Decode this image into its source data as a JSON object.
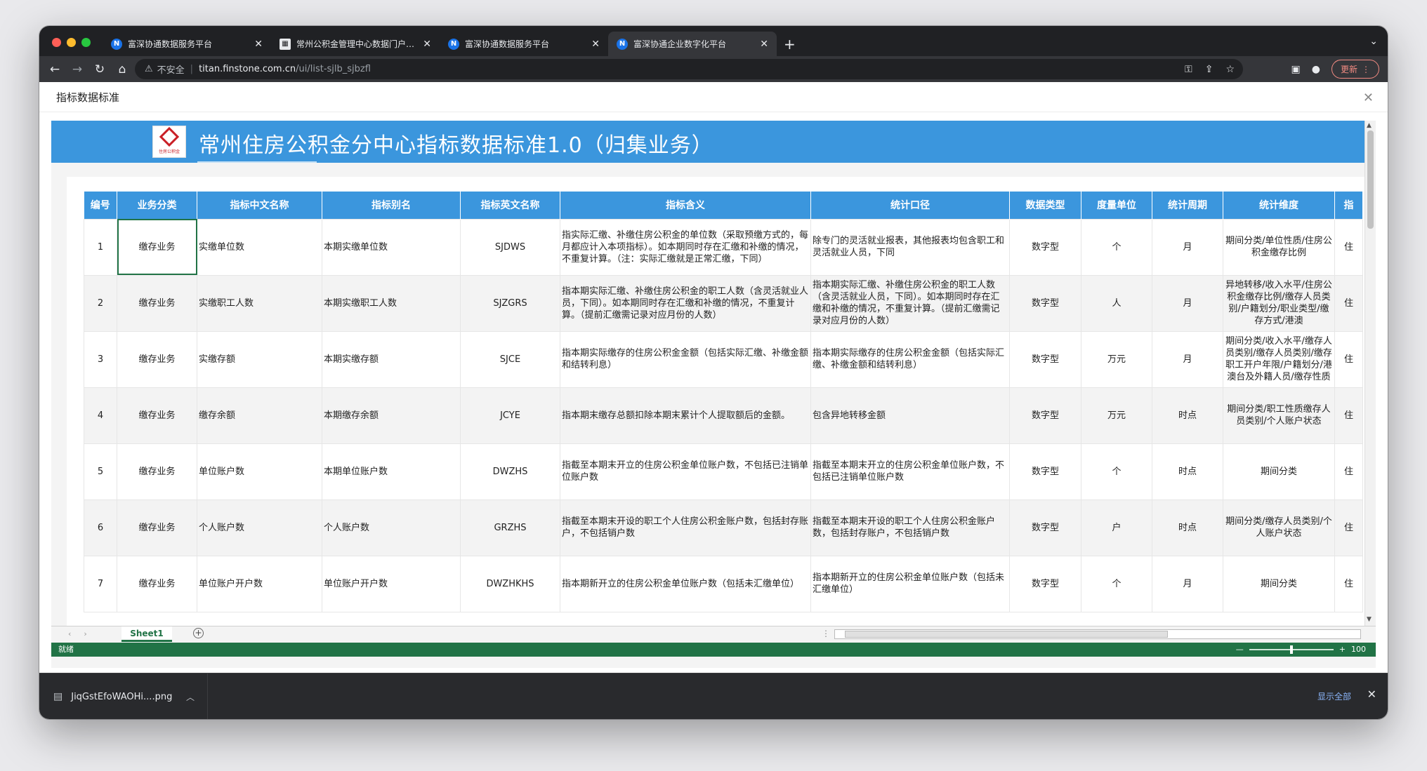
{
  "tabs": [
    {
      "title": "富深协通数据服务平台",
      "icon": "N",
      "active": false
    },
    {
      "title": "常州公积金管理中心数据门户建设",
      "icon": "doc",
      "active": false
    },
    {
      "title": "富深协通数据服务平台",
      "icon": "N",
      "active": false
    },
    {
      "title": "富深协通企业数字化平台",
      "icon": "N",
      "active": true
    }
  ],
  "toolbar": {
    "insecure_label": "不安全",
    "url_host": "titan.finstone.com.cn",
    "url_path": "/ui/list-sjlb_sjbzfl",
    "update_label": "更新"
  },
  "page": {
    "header_title": "指标数据标准",
    "banner_title": "常州住房公积金分中心指标数据标准1.0（归集业务）",
    "logo_text": "住房公积金"
  },
  "table": {
    "columns": [
      "编号",
      "业务分类",
      "指标中文名称",
      "指标别名",
      "指标英文名称",
      "指标含义",
      "统计口径",
      "数据类型",
      "度量单位",
      "统计周期",
      "统计维度",
      "指"
    ],
    "rows": [
      {
        "no": "1",
        "category": "缴存业务",
        "cn_name": "实缴单位数",
        "alias": "本期实缴单位数",
        "en_name": "SJDWS",
        "meaning": "指实际汇缴、补缴住房公积金的单位数（采取预缴方式的，每月都应计入本项指标）。如本期同时存在汇缴和补缴的情况，不重复计算。（注：实际汇缴就是正常汇缴，下同）",
        "caliber": "除专门的灵活就业报表，其他报表均包含职工和灵活就业人员，下同",
        "dtype": "数字型",
        "unit": "个",
        "period": "月",
        "dimension": "期间分类/单位性质/住房公积金缴存比例",
        "extra": "住"
      },
      {
        "no": "2",
        "category": "缴存业务",
        "cn_name": "实缴职工人数",
        "alias": "本期实缴职工人数",
        "en_name": "SJZGRS",
        "meaning": "指本期实际汇缴、补缴住房公积金的职工人数（含灵活就业人员，下同）。如本期同时存在汇缴和补缴的情况，不重复计算。（提前汇缴需记录对应月份的人数）",
        "caliber": "指本期实际汇缴、补缴住房公积金的职工人数（含灵活就业人员，下同）。如本期同时存在汇缴和补缴的情况，不重复计算。（提前汇缴需记录对应月份的人数）",
        "dtype": "数字型",
        "unit": "人",
        "period": "月",
        "dimension": "异地转移/收入水平/住房公积金缴存比例/缴存人员类别/户籍划分/职业类型/缴存方式/港澳",
        "extra": "住"
      },
      {
        "no": "3",
        "category": "缴存业务",
        "cn_name": "实缴存额",
        "alias": "本期实缴存额",
        "en_name": "SJCE",
        "meaning": "指本期实际缴存的住房公积金金额（包括实际汇缴、补缴金额和结转利息）",
        "caliber": "指本期实际缴存的住房公积金金额（包括实际汇缴、补缴金额和结转利息）",
        "dtype": "数字型",
        "unit": "万元",
        "period": "月",
        "dimension": "期间分类/收入水平/缴存人员类别/缴存人员类别/缴存职工开户年限/户籍划分/港澳台及外籍人员/缴存性质",
        "extra": "住"
      },
      {
        "no": "4",
        "category": "缴存业务",
        "cn_name": "缴存余额",
        "alias": "本期缴存余额",
        "en_name": "JCYE",
        "meaning": "指本期末缴存总额扣除本期末累计个人提取额后的金额。",
        "caliber": "包含异地转移金额",
        "dtype": "数字型",
        "unit": "万元",
        "period": "时点",
        "dimension": "期间分类/职工性质缴存人员类别/个人账户状态",
        "extra": "住"
      },
      {
        "no": "5",
        "category": "缴存业务",
        "cn_name": "单位账户数",
        "alias": "本期单位账户数",
        "en_name": "DWZHS",
        "meaning": "指截至本期末开立的住房公积金单位账户数，不包括已注销单位账户数",
        "caliber": "指截至本期末开立的住房公积金单位账户数，不包括已注销单位账户数",
        "dtype": "数字型",
        "unit": "个",
        "period": "时点",
        "dimension": "期间分类",
        "extra": "住"
      },
      {
        "no": "6",
        "category": "缴存业务",
        "cn_name": "个人账户数",
        "alias": "个人账户数",
        "en_name": "GRZHS",
        "meaning": "指截至本期末开设的职工个人住房公积金账户数，包括封存账户，不包括销户数",
        "caliber": "指截至本期末开设的职工个人住房公积金账户数，包括封存账户，不包括销户数",
        "dtype": "数字型",
        "unit": "户",
        "period": "时点",
        "dimension": "期间分类/缴存人员类别/个人账户状态",
        "extra": "住"
      },
      {
        "no": "7",
        "category": "缴存业务",
        "cn_name": "单位账户开户数",
        "alias": "单位账户开户数",
        "en_name": "DWZHKHS",
        "meaning": "指本期新开立的住房公积金单位账户数（包括未汇缴单位）",
        "caliber": "指本期新开立的住房公积金单位账户数（包括未汇缴单位）",
        "dtype": "数字型",
        "unit": "个",
        "period": "月",
        "dimension": "期间分类",
        "extra": "住"
      }
    ]
  },
  "sheetbar": {
    "sheet_name": "Sheet1",
    "add_label": "+",
    "nav_prev": "‹",
    "nav_next": "›"
  },
  "statusbar": {
    "ready": "就绪",
    "zoom_minus": "—",
    "zoom_plus": "+",
    "zoom_value": "100"
  },
  "downloads": {
    "file_name": "JiqGstEfoWAOHi....png",
    "show_all": "显示全部"
  },
  "colors": {
    "banner": "#3b96dd",
    "excel_green": "#217346",
    "header_bg": "#3b96dd"
  }
}
